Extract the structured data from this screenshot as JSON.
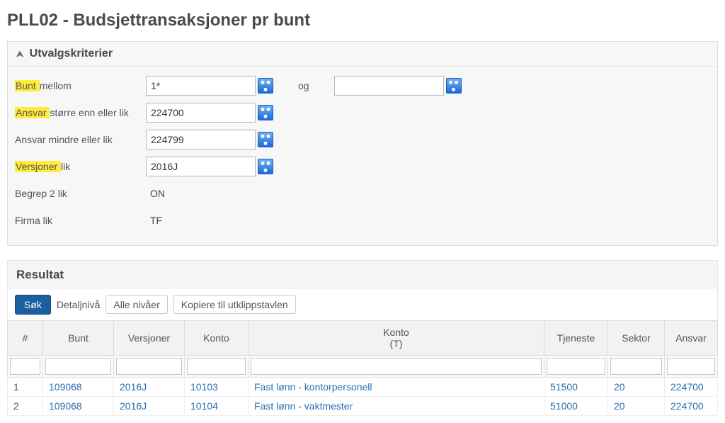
{
  "title": "PLL02 - Budsjettransaksjoner pr bunt",
  "criteria": {
    "panel_title": "Utvalgskriterier",
    "bunt_label_hl": "Bunt ",
    "bunt_label_rest": "mellom",
    "bunt_from": "1*",
    "og": "og",
    "bunt_to": "",
    "ansvar_label_hl": "Ansvar ",
    "ansvar_label_rest": "større enn eller lik",
    "ansvar_ge": "224700",
    "ansvar2_label": "Ansvar mindre eller lik",
    "ansvar_le": "224799",
    "versjoner_label_hl": "Versjoner ",
    "versjoner_label_rest": "lik",
    "versjoner": "2016J",
    "begrep_label": "Begrep 2 lik",
    "begrep_value": "ON",
    "firma_label": "Firma lik",
    "firma_value": "TF"
  },
  "result": {
    "header": "Resultat",
    "search_btn": "Søk",
    "detail_label": "Detaljnivå",
    "level_btn": "Alle nivåer",
    "copy_btn": "Kopiere til utklippstavlen",
    "columns": {
      "hash": "#",
      "bunt": "Bunt",
      "versjoner": "Versjoner",
      "konto": "Konto",
      "kontoT_line1": "Konto",
      "kontoT_line2": "(T)",
      "tjeneste": "Tjeneste",
      "sektor": "Sektor",
      "ansvar": "Ansvar"
    },
    "rows": [
      {
        "idx": "1",
        "bunt": "109068",
        "versjoner": "2016J",
        "konto": "10103",
        "kontoT": "Fast lønn - kontorpersonell",
        "tjeneste": "51500",
        "sektor": "20",
        "ansvar": "224700"
      },
      {
        "idx": "2",
        "bunt": "109068",
        "versjoner": "2016J",
        "konto": "10104",
        "kontoT": "Fast lønn - vaktmester",
        "tjeneste": "51000",
        "sektor": "20",
        "ansvar": "224700"
      }
    ]
  }
}
